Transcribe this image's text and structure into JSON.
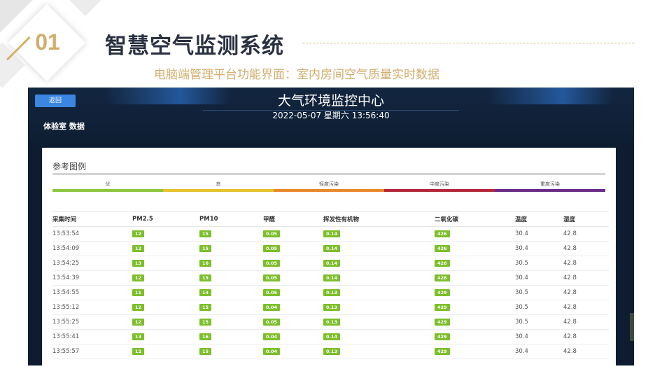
{
  "slide": {
    "number": "01",
    "title": "智慧空气监测系统",
    "subtitle": "电脑端管理平台功能界面：室内房间空气质量实时数据"
  },
  "screen": {
    "back_label": "返回",
    "title": "大气环境监控中心",
    "datetime": "2022-05-07 星期六 13:56:40",
    "room_label": "体验室 数据",
    "legend_title": "参考图例",
    "legend": [
      {
        "label": "优",
        "color": "#8cc63f"
      },
      {
        "label": "良",
        "color": "#e5c22e"
      },
      {
        "label": "轻度污染",
        "color": "#e8892b"
      },
      {
        "label": "中度污染",
        "color": "#b5283a"
      },
      {
        "label": "重度污染",
        "color": "#6a2c86"
      }
    ],
    "badge_color": "#7cbf2b",
    "columns": [
      "采集时间",
      "PM2.5",
      "PM10",
      "甲醛",
      "挥发性有机物",
      "二氧化碳",
      "温度",
      "湿度"
    ],
    "rows": [
      [
        "13:53:54",
        "12",
        "15",
        "0.05",
        "0.14",
        "426",
        "30.4",
        "42.8"
      ],
      [
        "13:54:09",
        "12",
        "15",
        "0.05",
        "0.14",
        "426",
        "30.4",
        "42.8"
      ],
      [
        "13:54:25",
        "13",
        "16",
        "0.05",
        "0.14",
        "426",
        "30.5",
        "42.8"
      ],
      [
        "13:54:39",
        "12",
        "15",
        "0.05",
        "0.14",
        "426",
        "30.4",
        "42.8"
      ],
      [
        "13:54:55",
        "11",
        "14",
        "0.05",
        "0.13",
        "429",
        "30.5",
        "42.8"
      ],
      [
        "13:55:12",
        "12",
        "15",
        "0.04",
        "0.13",
        "429",
        "30.5",
        "42.8"
      ],
      [
        "13:55:25",
        "12",
        "15",
        "0.05",
        "0.13",
        "429",
        "30.5",
        "42.8"
      ],
      [
        "13:55:41",
        "13",
        "16",
        "0.04",
        "0.14",
        "429",
        "30.4",
        "42.8"
      ],
      [
        "13:55:57",
        "12",
        "15",
        "0.04",
        "0.13",
        "429",
        "30.4",
        "42.8"
      ]
    ]
  }
}
